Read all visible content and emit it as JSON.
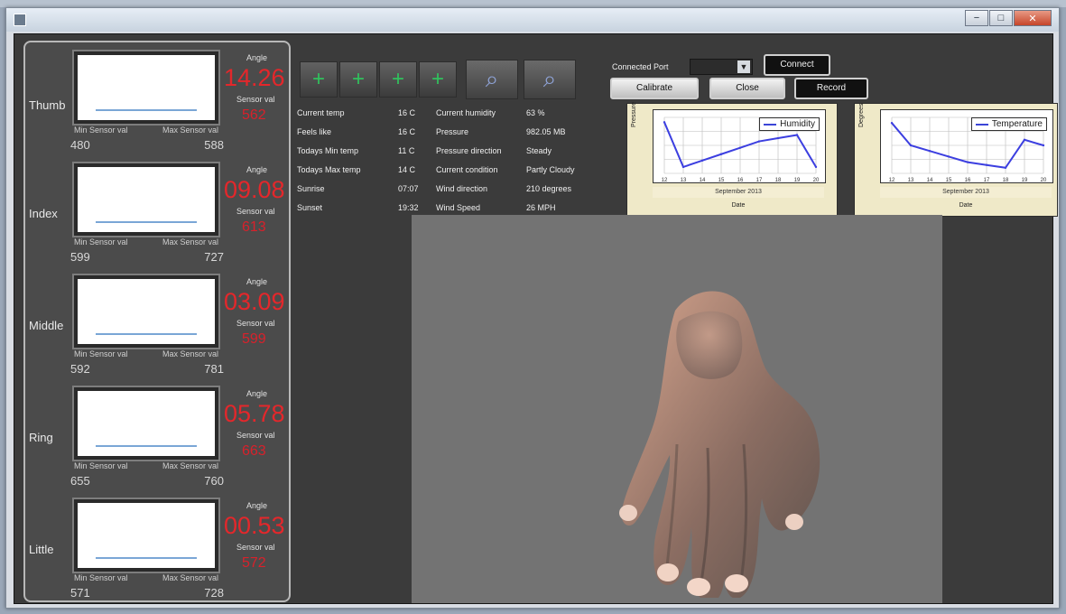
{
  "window": {
    "controls": {
      "minimize": "−",
      "maximize": "□",
      "close": "✕"
    }
  },
  "fingers": [
    {
      "name": "Thumb",
      "angle_label": "Angle",
      "angle": "14.26",
      "sensor_label": "Sensor val",
      "sensor": "562",
      "min_label": "Min Sensor val",
      "max_label": "Max Sensor val",
      "min": "480",
      "max": "588"
    },
    {
      "name": "Index",
      "angle_label": "Angle",
      "angle": "09.08",
      "sensor_label": "Sensor val",
      "sensor": "613",
      "min_label": "Min Sensor val",
      "max_label": "Max Sensor val",
      "min": "599",
      "max": "727"
    },
    {
      "name": "Middle",
      "angle_label": "Angle",
      "angle": "03.09",
      "sensor_label": "Sensor val",
      "sensor": "599",
      "min_label": "Min Sensor val",
      "max_label": "Max Sensor val",
      "min": "592",
      "max": "781"
    },
    {
      "name": "Ring",
      "angle_label": "Angle",
      "angle": "05.78",
      "sensor_label": "Sensor val",
      "sensor": "663",
      "min_label": "Min Sensor val",
      "max_label": "Max Sensor val",
      "min": "655",
      "max": "760"
    },
    {
      "name": "Little",
      "angle_label": "Angle",
      "angle": "00.53",
      "sensor_label": "Sensor val",
      "sensor": "572",
      "min_label": "Min Sensor val",
      "max_label": "Max Sensor val",
      "min": "571",
      "max": "728"
    }
  ],
  "toolbar": {
    "icons": [
      "plus-icon",
      "plus-icon",
      "plus-icon",
      "plus-icon",
      "zoom-in-icon",
      "zoom-out-icon"
    ]
  },
  "connection": {
    "port_label": "Connected Port",
    "port_value": "",
    "connect": "Connect",
    "calibrate": "Calibrate",
    "close": "Close",
    "record": "Record"
  },
  "weather": [
    {
      "label": "Current temp",
      "value": "16 C"
    },
    {
      "label": "Feels like",
      "value": "16 C"
    },
    {
      "label": "Todays Min temp",
      "value": "11 C"
    },
    {
      "label": "Todays Max temp",
      "value": "14 C"
    },
    {
      "label": "Sunrise",
      "value": "07:07"
    },
    {
      "label": "Sunset",
      "value": "19:32"
    },
    {
      "label": "Current humidity",
      "value": "63 %"
    },
    {
      "label": "Pressure",
      "value": "982.05 MB"
    },
    {
      "label": "Pressure direction",
      "value": "Steady"
    },
    {
      "label": "Current condition",
      "value": "Partly Cloudy"
    },
    {
      "label": "Wind direction",
      "value": "210 degrees"
    },
    {
      "label": "Wind Speed",
      "value": "26 MPH"
    }
  ],
  "chart_data": [
    {
      "type": "line",
      "xlabel": "Date",
      "ylabel": "Pressure",
      "axis_group": "September 2013",
      "legend": "Humidity",
      "x": [
        12,
        13,
        14,
        15,
        16,
        17,
        18,
        19,
        20
      ],
      "values": [
        92,
        64,
        68,
        72,
        76,
        80,
        82,
        84,
        64
      ],
      "ylim": [
        60,
        95
      ]
    },
    {
      "type": "line",
      "xlabel": "Date",
      "ylabel": "Degrees",
      "axis_group": "September 2013",
      "legend": "Temperature",
      "x": [
        12,
        13,
        14,
        15,
        16,
        17,
        18,
        19,
        20
      ],
      "values": [
        18,
        14,
        13,
        12,
        11,
        10.5,
        10,
        15,
        14
      ],
      "ylim": [
        9,
        19
      ]
    }
  ]
}
